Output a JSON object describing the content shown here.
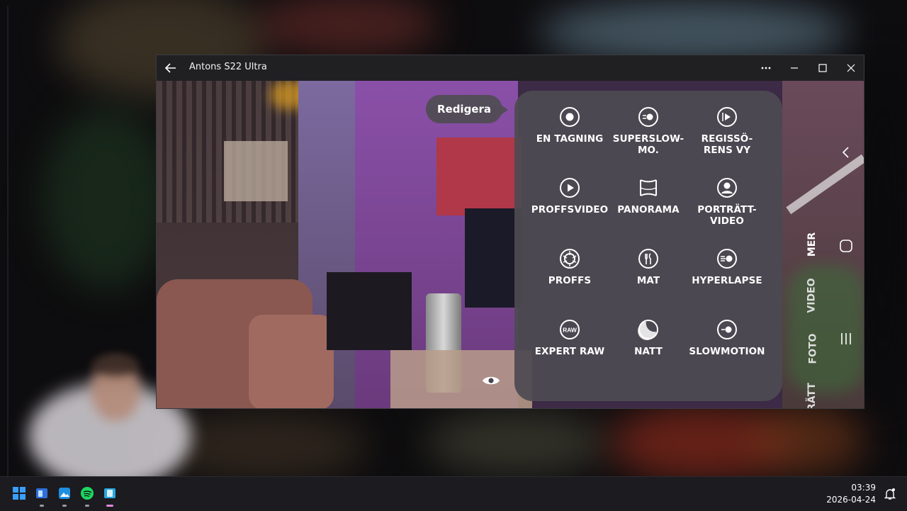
{
  "window": {
    "title": "Antons S22 Ultra",
    "controls": [
      "more-icon",
      "minimize-icon",
      "maximize-icon",
      "close-icon"
    ]
  },
  "camera": {
    "edit_label": "Redigera",
    "modes": [
      {
        "label": "EN TAGNING",
        "icon": "single-take-icon"
      },
      {
        "label": "SUPERSLOW-\nMO.",
        "icon": "super-slow-mo-icon"
      },
      {
        "label": "REGISSÖ-\nRENS VY",
        "icon": "directors-view-icon"
      },
      {
        "label": "PROFFSVIDEO",
        "icon": "pro-video-icon"
      },
      {
        "label": "PANORAMA",
        "icon": "panorama-icon"
      },
      {
        "label": "PORTRÄTT-\nVIDEO",
        "icon": "portrait-video-icon"
      },
      {
        "label": "PROFFS",
        "icon": "pro-icon"
      },
      {
        "label": "MAT",
        "icon": "food-icon"
      },
      {
        "label": "HYPERLAPSE",
        "icon": "hyperlapse-icon"
      },
      {
        "label": "EXPERT RAW",
        "icon": "expert-raw-icon"
      },
      {
        "label": "NATT",
        "icon": "night-icon"
      },
      {
        "label": "SLOWMOTION",
        "icon": "slow-motion-icon"
      }
    ],
    "raw_badge": "RAW",
    "side_tabs": {
      "more": "MER",
      "video": "VIDEO",
      "photo": "FOTO",
      "portrait": "RÄTT"
    }
  },
  "taskbar": {
    "apps": [
      "start-icon",
      "phone-link-icon",
      "photos-icon",
      "spotify-icon",
      "phone-mirror-icon"
    ],
    "clock_time": "03:39",
    "clock_date": "2026-04-24"
  },
  "colors": {
    "window_bg": "#202023",
    "panel_bg": "#4e4a52",
    "taskbar_bg": "#1c1b20"
  }
}
